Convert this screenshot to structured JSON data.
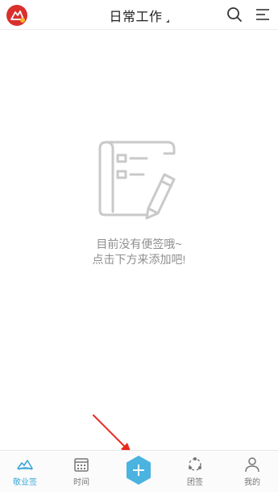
{
  "header": {
    "title": "日常工作",
    "logo_icon": "app-logo-icon",
    "search_icon": "search-icon",
    "menu_icon": "menu-icon"
  },
  "empty_state": {
    "icon": "note-pencil-icon",
    "line1": "目前没有便签哦~",
    "line2": "点击下方来添加吧!"
  },
  "bottom_nav": {
    "items": [
      {
        "label": "敬业签",
        "icon": "cloud-home-icon",
        "active": true
      },
      {
        "label": "时间",
        "icon": "calendar-icon",
        "active": false
      },
      {
        "label": "",
        "icon": "add-icon",
        "active": false
      },
      {
        "label": "团签",
        "icon": "team-icon",
        "active": false
      },
      {
        "label": "我的",
        "icon": "user-icon",
        "active": false
      }
    ]
  },
  "colors": {
    "accent": "#3ea8d8",
    "logo": "#d9302c",
    "arrow": "#e8291f",
    "empty_text": "#8f8f8f"
  }
}
